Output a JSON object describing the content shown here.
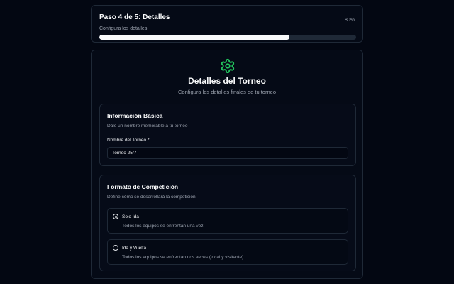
{
  "progress": {
    "title": "Paso 4 de 5: Detalles",
    "subtitle": "Configura los detalles",
    "percent_label": "80%",
    "fraction": 0.74
  },
  "header": {
    "icon": "gear-icon",
    "icon_color": "#22c55e",
    "title": "Detalles del Torneo",
    "subtitle": "Configura los detalles finales de tu torneo"
  },
  "basic_info": {
    "title": "Información Básica",
    "description": "Dale un nombre memorable a tu torneo",
    "name_label": "Nombre del Torneo *",
    "name_value": "Torneo 25/7"
  },
  "format": {
    "title": "Formato de Competición",
    "description": "Define cómo se desarrollará la competición",
    "options": [
      {
        "label": "Solo Ida",
        "description": "Todos los equipos se enfrentan una vez.",
        "selected": true
      },
      {
        "label": "Ida y Vuelta",
        "description": "Todos los equipos se enfrentan dos veces (local y visitante).",
        "selected": false
      }
    ]
  }
}
